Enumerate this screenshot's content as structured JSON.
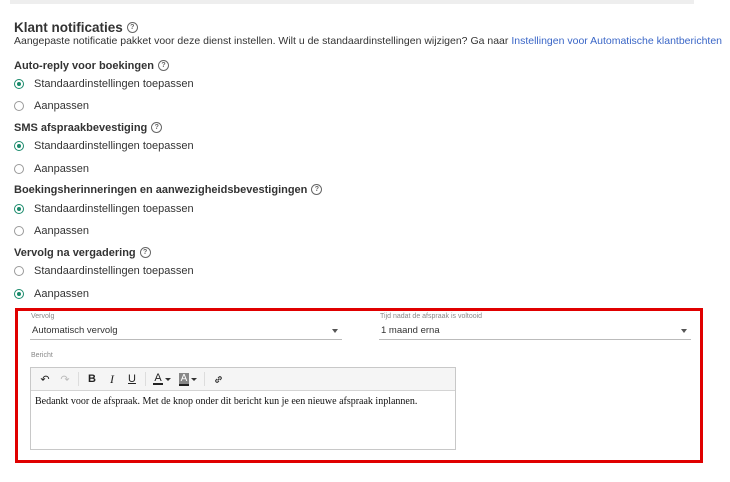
{
  "header": {
    "title": "Klant notificaties",
    "subtitle": "Aangepaste notificatie pakket voor deze dienst instellen. Wilt u de standaardinstellingen wijzigen? Ga naar",
    "link": "Instellingen voor Automatische klantberichten"
  },
  "help_glyph": "?",
  "sections": [
    {
      "title": "Auto-reply voor boekingen",
      "options": [
        {
          "label": "Standaardinstellingen toepassen",
          "checked": true
        },
        {
          "label": "Aanpassen",
          "checked": false
        }
      ]
    },
    {
      "title": "SMS afspraakbevestiging",
      "options": [
        {
          "label": "Standaardinstellingen toepassen",
          "checked": true
        },
        {
          "label": "Aanpassen",
          "checked": false
        }
      ]
    },
    {
      "title": "Boekingsherinneringen en aanwezigheidsbevestigingen",
      "options": [
        {
          "label": "Standaardinstellingen toepassen",
          "checked": true
        },
        {
          "label": "Aanpassen",
          "checked": false
        }
      ]
    },
    {
      "title": "Vervolg na vergadering",
      "options": [
        {
          "label": "Standaardinstellingen toepassen",
          "checked": false
        },
        {
          "label": "Aanpassen",
          "checked": true
        }
      ]
    }
  ],
  "custom_panel": {
    "vervolg_label": "Vervolg",
    "vervolg_value": "Automatisch vervolg",
    "time_label": "Tijd nadat de afspraak is voltooid",
    "time_value": "1 maand erna",
    "message_label": "Bericht",
    "message_text": "Bedankt voor de afspraak. Met de knop onder dit bericht kun je een nieuwe afspraak inplannen."
  },
  "toolbar": {
    "undo": "↶",
    "redo": "↷",
    "bold": "B",
    "italic": "I",
    "underline": "U",
    "text_color": "A",
    "bg_color": "A",
    "link": "🔗"
  },
  "colors": {
    "accent": "#1a8a6b",
    "link": "#3a66c7",
    "highlight": "#e00000"
  }
}
